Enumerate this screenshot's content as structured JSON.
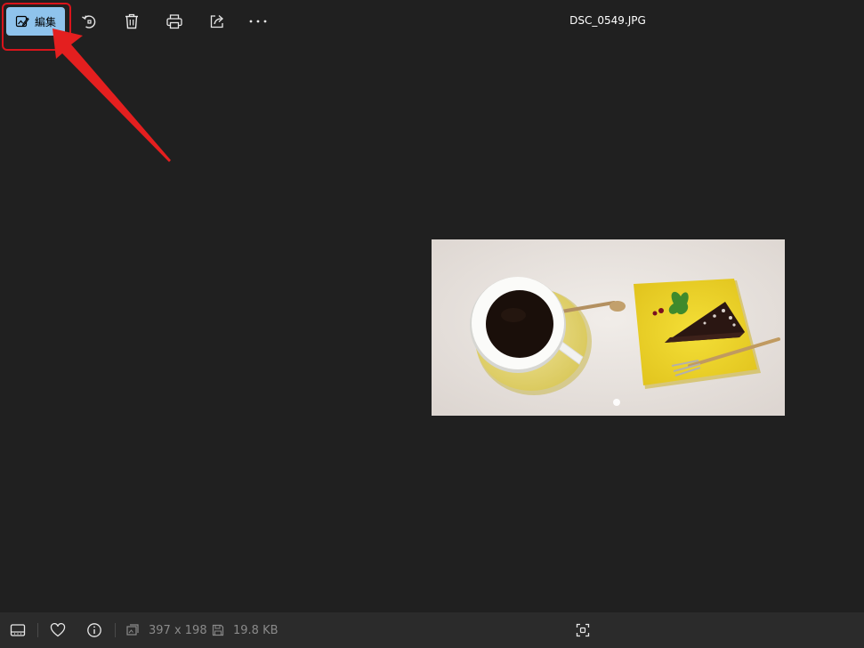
{
  "toolbar": {
    "edit_label": "編集",
    "file_name": "DSC_0549.JPG",
    "icons": [
      "edit-icon",
      "rotate-icon",
      "delete-icon",
      "print-icon",
      "share-icon",
      "more-icon"
    ]
  },
  "statusbar": {
    "dimensions": "397 x 198",
    "file_size": "19.8 KB",
    "icons": [
      "filmstrip-icon",
      "favorite-icon",
      "info-icon",
      "dimensions-icon",
      "save-icon",
      "fit-screen-icon"
    ]
  },
  "colors": {
    "background": "#202020",
    "statusbar": "#2b2b2b",
    "accent_button": "#8fc3ec",
    "annotation_red": "#e41f1f"
  }
}
